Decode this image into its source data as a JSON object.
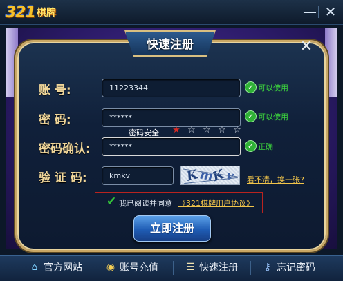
{
  "app": {
    "logo_number": "321",
    "logo_text": "棋牌",
    "minimize_glyph": "—",
    "close_glyph": "✕"
  },
  "dialog": {
    "title": "快速注册",
    "close_glyph": "✕"
  },
  "form": {
    "account_label": "账   号:",
    "account_value": "11223344",
    "account_status": "可以使用",
    "password_label": "密   码:",
    "password_value": "******",
    "password_status": "可以使用",
    "strength_label": "密码安全",
    "strength_stars_total": 5,
    "strength_stars_filled": 1,
    "confirm_label": "密码确认:",
    "confirm_value": "******",
    "confirm_status": "正确",
    "captcha_label": "验 证 码:",
    "captcha_value": "kmkv",
    "captcha_image_text": "KmKv",
    "captcha_refresh": "看不清，换一张?",
    "agree_text": "我已阅读并同意",
    "agree_link": "《321棋牌用户协议》",
    "agree_checked": true,
    "submit_label": "立即注册"
  },
  "nav": {
    "home_label": "官方网站",
    "recharge_label": "账号充值",
    "register_label": "快速注册",
    "forgot_label": "忘记密码"
  },
  "icons": {
    "ok": "check-circle-icon",
    "star": "star-icon",
    "home": "home-icon",
    "recharge": "coin-icon",
    "register": "document-icon",
    "forgot": "key-icon"
  },
  "colors": {
    "label_gold": "#f1d79a",
    "ok_green": "#3bd03d",
    "link_yellow": "#f1c44a",
    "star_active": "#d82a23",
    "agree_border": "#b9231f"
  }
}
